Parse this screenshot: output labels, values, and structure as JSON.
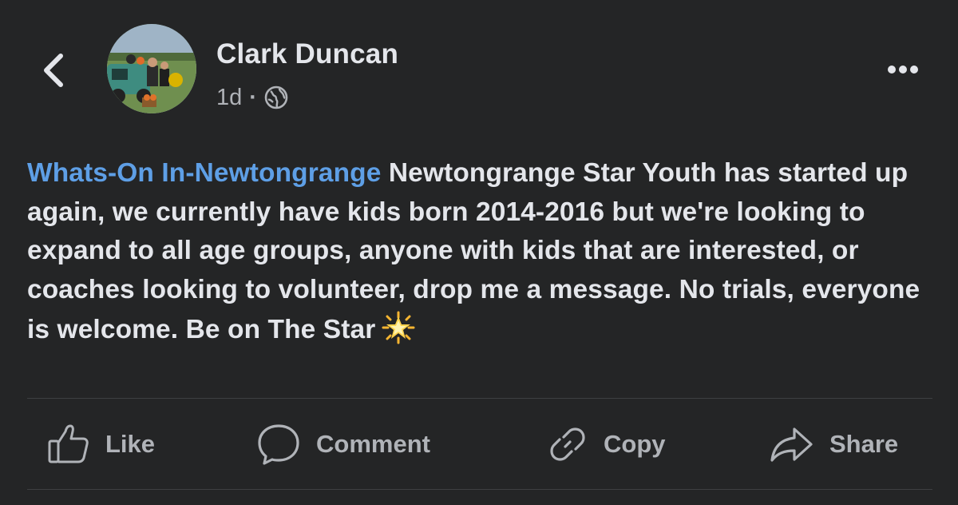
{
  "post": {
    "author": "Clark Duncan",
    "timestamp": "1d",
    "separator": "·",
    "audience_icon": "globe-icon",
    "mention": "Whats-On In-Newtongrange",
    "body": " Newtongrange Star Youth has started up again, we currently have kids born 2014-2016 but we're looking to expand to all age groups, anyone with kids that are interested, or coaches looking to volunteer, drop me a message. No trials, everyone is welcome. Be on The Star",
    "emoji": "glowing-star-emoji"
  },
  "header": {
    "back_icon": "chevron-left-icon",
    "more_icon": "more-options-icon"
  },
  "actions": {
    "like": "Like",
    "comment": "Comment",
    "copy": "Copy",
    "share": "Share"
  },
  "colors": {
    "background": "#242526",
    "primary_text": "#e4e6eb",
    "secondary_text": "#b0b3b8",
    "mention": "#5e9fe6",
    "divider": "#3e4042"
  }
}
